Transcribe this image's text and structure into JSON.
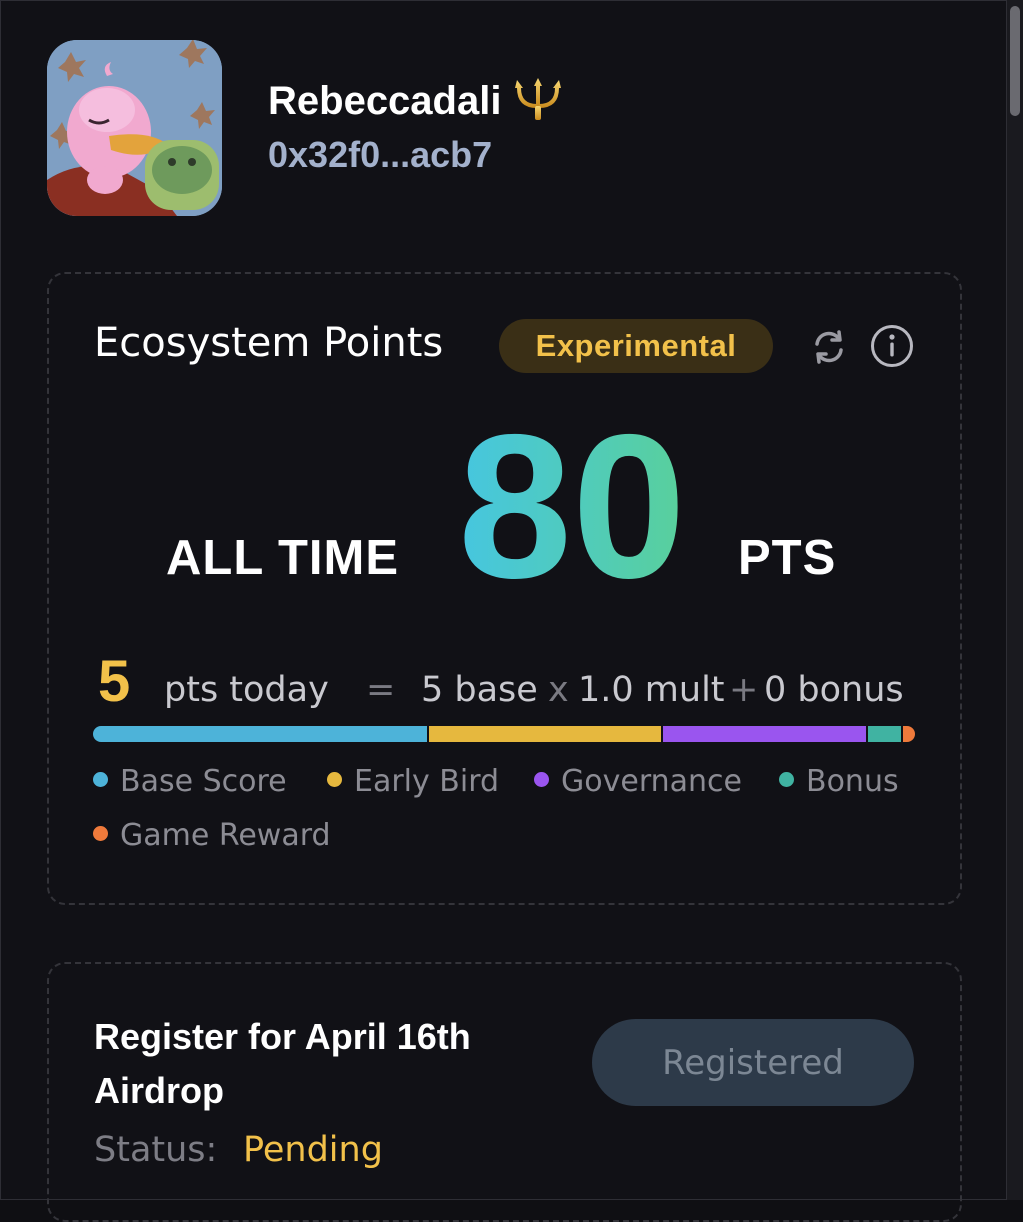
{
  "profile": {
    "username": "Rebeccadali",
    "badge_icon": "trident-icon",
    "address": "0x32f0...acb7"
  },
  "points": {
    "title": "Ecosystem Points",
    "badge": "Experimental",
    "all_time_label": "ALL TIME",
    "all_time_value": "80",
    "unit": "PTS",
    "today_value": "5",
    "today_label": "pts today",
    "equals": "=",
    "base": "5 base",
    "times": "x",
    "mult": "1.0 mult",
    "plus": "+",
    "bonus": "0 bonus",
    "breakdown": [
      {
        "label": "Base Score",
        "color": "#4db3d9",
        "share": 0.41
      },
      {
        "label": "Early Bird",
        "color": "#e6b83e",
        "share": 0.285
      },
      {
        "label": "Governance",
        "color": "#9a55ef",
        "share": 0.25
      },
      {
        "label": "Bonus",
        "color": "#40b3a2",
        "share": 0.04
      },
      {
        "label": "Game Reward",
        "color": "#ef7a3b",
        "share": 0.015
      }
    ]
  },
  "airdrop": {
    "title": "Register for April 16th Airdrop",
    "button_label": "Registered",
    "status_label": "Status:",
    "status_value": "Pending"
  },
  "colors": {
    "accent_yellow": "#f2c14a",
    "gradient_start": "#46c6e0",
    "gradient_end": "#59d09b"
  }
}
